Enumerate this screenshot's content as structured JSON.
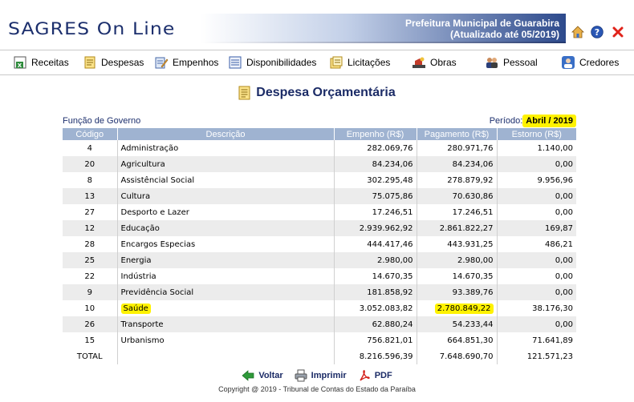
{
  "header": {
    "brand": "SAGRES On Line",
    "org_name": "Prefeitura Municipal de Guarabira",
    "updated": "(Atualizado até 05/2019)",
    "icons": [
      "home-icon",
      "help-icon",
      "close-icon"
    ]
  },
  "nav": {
    "items": [
      {
        "label": "Receitas",
        "icon": "receitas-icon"
      },
      {
        "label": "Despesas",
        "icon": "despesas-icon"
      },
      {
        "label": "Empenhos",
        "icon": "empenhos-icon"
      },
      {
        "label": "Disponibilidades",
        "icon": "disponibilidades-icon"
      },
      {
        "label": "Licitações",
        "icon": "licitacoes-icon"
      },
      {
        "label": "Obras",
        "icon": "obras-icon"
      },
      {
        "label": "Pessoal",
        "icon": "pessoal-icon"
      },
      {
        "label": "Credores",
        "icon": "credores-icon"
      }
    ]
  },
  "page": {
    "title": "Despesa Orçamentária",
    "funcao_label": "Função de Governo",
    "periodo_label": "Período:",
    "periodo_value": "Abril / 2019"
  },
  "table": {
    "headers": [
      "Código",
      "Descrição",
      "Empenho (R$)",
      "Pagamento (R$)",
      "Estorno (R$)"
    ],
    "rows": [
      {
        "codigo": "4",
        "descricao": "Administração",
        "empenho": "282.069,76",
        "pagamento": "280.971,76",
        "estorno": "1.140,00"
      },
      {
        "codigo": "20",
        "descricao": "Agricultura",
        "empenho": "84.234,06",
        "pagamento": "84.234,06",
        "estorno": "0,00"
      },
      {
        "codigo": "8",
        "descricao": "Assistêncial Social",
        "empenho": "302.295,48",
        "pagamento": "278.879,92",
        "estorno": "9.956,96"
      },
      {
        "codigo": "13",
        "descricao": "Cultura",
        "empenho": "75.075,86",
        "pagamento": "70.630,86",
        "estorno": "0,00"
      },
      {
        "codigo": "27",
        "descricao": "Desporto e Lazer",
        "empenho": "17.246,51",
        "pagamento": "17.246,51",
        "estorno": "0,00"
      },
      {
        "codigo": "12",
        "descricao": "Educação",
        "empenho": "2.939.962,92",
        "pagamento": "2.861.822,27",
        "estorno": "169,87"
      },
      {
        "codigo": "28",
        "descricao": "Encargos Especias",
        "empenho": "444.417,46",
        "pagamento": "443.931,25",
        "estorno": "486,21"
      },
      {
        "codigo": "25",
        "descricao": "Energia",
        "empenho": "2.980,00",
        "pagamento": "2.980,00",
        "estorno": "0,00"
      },
      {
        "codigo": "22",
        "descricao": "Indústria",
        "empenho": "14.670,35",
        "pagamento": "14.670,35",
        "estorno": "0,00"
      },
      {
        "codigo": "9",
        "descricao": "Previdência Social",
        "empenho": "181.858,92",
        "pagamento": "93.389,76",
        "estorno": "0,00"
      },
      {
        "codigo": "10",
        "descricao": "Saúde",
        "empenho": "3.052.083,82",
        "pagamento": "2.780.849,22",
        "estorno": "38.176,30"
      },
      {
        "codigo": "26",
        "descricao": "Transporte",
        "empenho": "62.880,24",
        "pagamento": "54.233,44",
        "estorno": "0,00"
      },
      {
        "codigo": "15",
        "descricao": "Urbanismo",
        "empenho": "756.821,01",
        "pagamento": "664.851,30",
        "estorno": "71.641,89"
      }
    ],
    "total": {
      "label": "TOTAL",
      "empenho": "8.216.596,39",
      "pagamento": "7.648.690,70",
      "estorno": "121.571,23"
    }
  },
  "footer": {
    "voltar": "Voltar",
    "imprimir": "Imprimir",
    "pdf": "PDF",
    "copyright": "Copyright @ 2019 - Tribunal de Contas do Estado da Paraíba"
  },
  "colors": {
    "brand": "#1c2f6d",
    "header_bar": "#2d4a8c",
    "table_header": "#9fb3d1",
    "highlight": "#fff200"
  }
}
